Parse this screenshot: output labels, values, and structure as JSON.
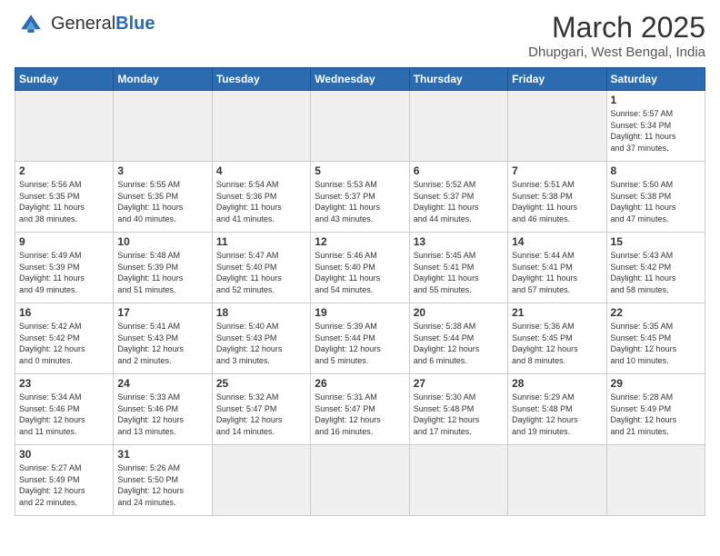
{
  "header": {
    "logo_general": "General",
    "logo_blue": "Blue",
    "month_title": "March 2025",
    "location": "Dhupgari, West Bengal, India"
  },
  "weekdays": [
    "Sunday",
    "Monday",
    "Tuesday",
    "Wednesday",
    "Thursday",
    "Friday",
    "Saturday"
  ],
  "weeks": [
    [
      {
        "day": "",
        "info": "",
        "empty": true
      },
      {
        "day": "",
        "info": "",
        "empty": true
      },
      {
        "day": "",
        "info": "",
        "empty": true
      },
      {
        "day": "",
        "info": "",
        "empty": true
      },
      {
        "day": "",
        "info": "",
        "empty": true
      },
      {
        "day": "",
        "info": "",
        "empty": true
      },
      {
        "day": "1",
        "info": "Sunrise: 5:57 AM\nSunset: 5:34 PM\nDaylight: 11 hours\nand 37 minutes.",
        "empty": false
      }
    ],
    [
      {
        "day": "2",
        "info": "Sunrise: 5:56 AM\nSunset: 5:35 PM\nDaylight: 11 hours\nand 38 minutes.",
        "empty": false
      },
      {
        "day": "3",
        "info": "Sunrise: 5:55 AM\nSunset: 5:35 PM\nDaylight: 11 hours\nand 40 minutes.",
        "empty": false
      },
      {
        "day": "4",
        "info": "Sunrise: 5:54 AM\nSunset: 5:36 PM\nDaylight: 11 hours\nand 41 minutes.",
        "empty": false
      },
      {
        "day": "5",
        "info": "Sunrise: 5:53 AM\nSunset: 5:37 PM\nDaylight: 11 hours\nand 43 minutes.",
        "empty": false
      },
      {
        "day": "6",
        "info": "Sunrise: 5:52 AM\nSunset: 5:37 PM\nDaylight: 11 hours\nand 44 minutes.",
        "empty": false
      },
      {
        "day": "7",
        "info": "Sunrise: 5:51 AM\nSunset: 5:38 PM\nDaylight: 11 hours\nand 46 minutes.",
        "empty": false
      },
      {
        "day": "8",
        "info": "Sunrise: 5:50 AM\nSunset: 5:38 PM\nDaylight: 11 hours\nand 47 minutes.",
        "empty": false
      }
    ],
    [
      {
        "day": "9",
        "info": "Sunrise: 5:49 AM\nSunset: 5:39 PM\nDaylight: 11 hours\nand 49 minutes.",
        "empty": false
      },
      {
        "day": "10",
        "info": "Sunrise: 5:48 AM\nSunset: 5:39 PM\nDaylight: 11 hours\nand 51 minutes.",
        "empty": false
      },
      {
        "day": "11",
        "info": "Sunrise: 5:47 AM\nSunset: 5:40 PM\nDaylight: 11 hours\nand 52 minutes.",
        "empty": false
      },
      {
        "day": "12",
        "info": "Sunrise: 5:46 AM\nSunset: 5:40 PM\nDaylight: 11 hours\nand 54 minutes.",
        "empty": false
      },
      {
        "day": "13",
        "info": "Sunrise: 5:45 AM\nSunset: 5:41 PM\nDaylight: 11 hours\nand 55 minutes.",
        "empty": false
      },
      {
        "day": "14",
        "info": "Sunrise: 5:44 AM\nSunset: 5:41 PM\nDaylight: 11 hours\nand 57 minutes.",
        "empty": false
      },
      {
        "day": "15",
        "info": "Sunrise: 5:43 AM\nSunset: 5:42 PM\nDaylight: 11 hours\nand 58 minutes.",
        "empty": false
      }
    ],
    [
      {
        "day": "16",
        "info": "Sunrise: 5:42 AM\nSunset: 5:42 PM\nDaylight: 12 hours\nand 0 minutes.",
        "empty": false
      },
      {
        "day": "17",
        "info": "Sunrise: 5:41 AM\nSunset: 5:43 PM\nDaylight: 12 hours\nand 2 minutes.",
        "empty": false
      },
      {
        "day": "18",
        "info": "Sunrise: 5:40 AM\nSunset: 5:43 PM\nDaylight: 12 hours\nand 3 minutes.",
        "empty": false
      },
      {
        "day": "19",
        "info": "Sunrise: 5:39 AM\nSunset: 5:44 PM\nDaylight: 12 hours\nand 5 minutes.",
        "empty": false
      },
      {
        "day": "20",
        "info": "Sunrise: 5:38 AM\nSunset: 5:44 PM\nDaylight: 12 hours\nand 6 minutes.",
        "empty": false
      },
      {
        "day": "21",
        "info": "Sunrise: 5:36 AM\nSunset: 5:45 PM\nDaylight: 12 hours\nand 8 minutes.",
        "empty": false
      },
      {
        "day": "22",
        "info": "Sunrise: 5:35 AM\nSunset: 5:45 PM\nDaylight: 12 hours\nand 10 minutes.",
        "empty": false
      }
    ],
    [
      {
        "day": "23",
        "info": "Sunrise: 5:34 AM\nSunset: 5:46 PM\nDaylight: 12 hours\nand 11 minutes.",
        "empty": false
      },
      {
        "day": "24",
        "info": "Sunrise: 5:33 AM\nSunset: 5:46 PM\nDaylight: 12 hours\nand 13 minutes.",
        "empty": false
      },
      {
        "day": "25",
        "info": "Sunrise: 5:32 AM\nSunset: 5:47 PM\nDaylight: 12 hours\nand 14 minutes.",
        "empty": false
      },
      {
        "day": "26",
        "info": "Sunrise: 5:31 AM\nSunset: 5:47 PM\nDaylight: 12 hours\nand 16 minutes.",
        "empty": false
      },
      {
        "day": "27",
        "info": "Sunrise: 5:30 AM\nSunset: 5:48 PM\nDaylight: 12 hours\nand 17 minutes.",
        "empty": false
      },
      {
        "day": "28",
        "info": "Sunrise: 5:29 AM\nSunset: 5:48 PM\nDaylight: 12 hours\nand 19 minutes.",
        "empty": false
      },
      {
        "day": "29",
        "info": "Sunrise: 5:28 AM\nSunset: 5:49 PM\nDaylight: 12 hours\nand 21 minutes.",
        "empty": false
      }
    ],
    [
      {
        "day": "30",
        "info": "Sunrise: 5:27 AM\nSunset: 5:49 PM\nDaylight: 12 hours\nand 22 minutes.",
        "empty": false
      },
      {
        "day": "31",
        "info": "Sunrise: 5:26 AM\nSunset: 5:50 PM\nDaylight: 12 hours\nand 24 minutes.",
        "empty": false
      },
      {
        "day": "",
        "info": "",
        "empty": true
      },
      {
        "day": "",
        "info": "",
        "empty": true
      },
      {
        "day": "",
        "info": "",
        "empty": true
      },
      {
        "day": "",
        "info": "",
        "empty": true
      },
      {
        "day": "",
        "info": "",
        "empty": true
      }
    ]
  ]
}
